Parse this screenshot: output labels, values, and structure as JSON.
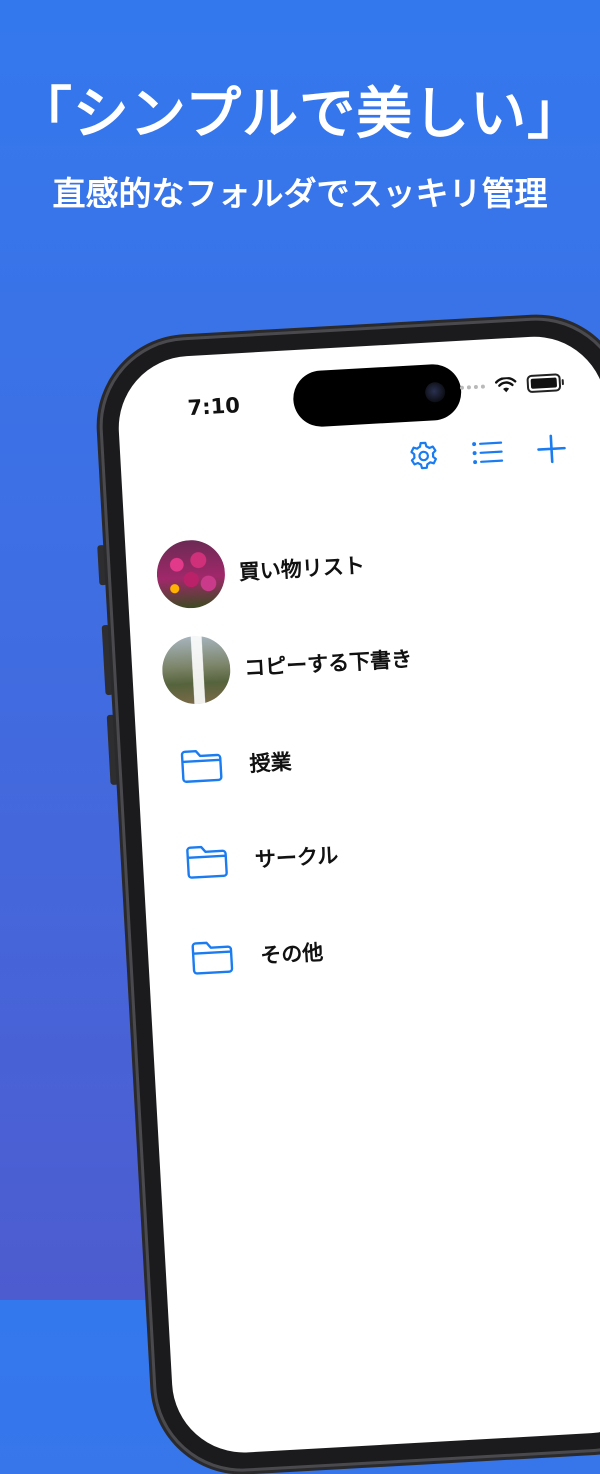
{
  "promo": {
    "headline": "「シンプルで美しい」",
    "subheadline": "直感的なフォルダでスッキリ管理"
  },
  "status_bar": {
    "time": "7:10"
  },
  "toolbar": {
    "icons": [
      "gear-icon",
      "list-icon",
      "plus-icon"
    ]
  },
  "items": [
    {
      "label": "買い物リスト",
      "icon": "photo-thumbnail-flowers"
    },
    {
      "label": "コピーする下書き",
      "icon": "photo-thumbnail-waterfall"
    },
    {
      "label": "授業",
      "icon": "folder-icon"
    },
    {
      "label": "サークル",
      "icon": "folder-icon"
    },
    {
      "label": "その他",
      "icon": "folder-icon"
    }
  ],
  "colors": {
    "background_top": "#3478ee",
    "background_bottom": "#4d5ccf",
    "accent": "#1a7cf0",
    "text": "#111111"
  }
}
